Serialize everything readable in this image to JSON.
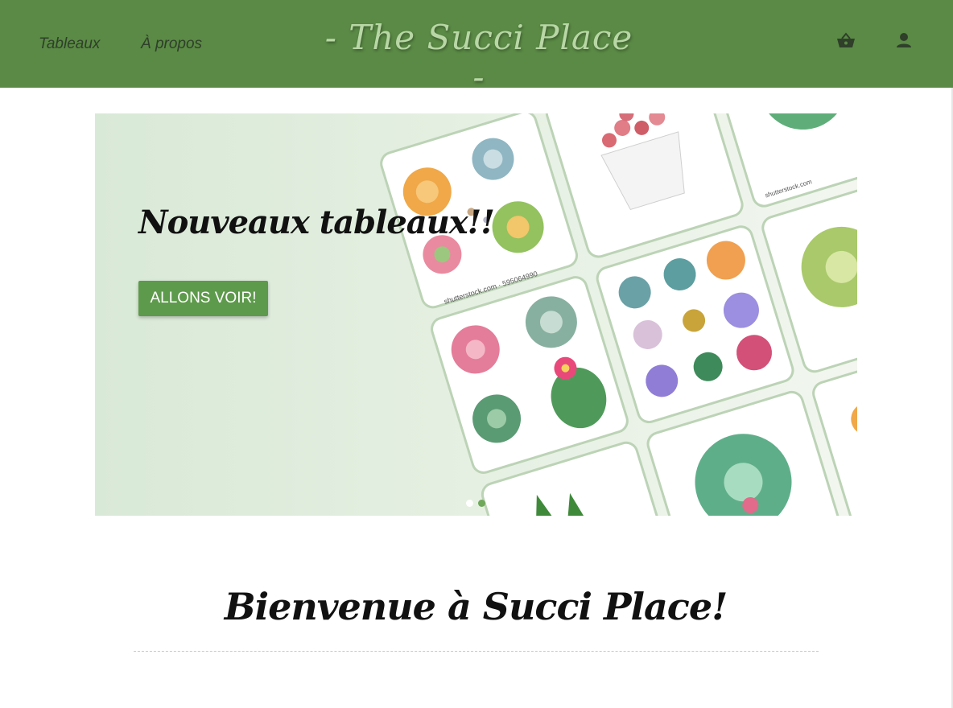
{
  "nav": {
    "links": [
      "Tableaux",
      "À propos"
    ],
    "brand": "- The Succi Place -",
    "icons": [
      "basket-icon",
      "user-icon"
    ]
  },
  "hero": {
    "title": "Nouveaux tableaux!!",
    "cta_label": "ALLONS VOIR!",
    "slides_count": 2,
    "active_slide": 2,
    "card_captions": [
      "shutterstock.com · 595064990",
      "shutterstock.com"
    ]
  },
  "welcome": {
    "title": "Bienvenue à Succi Place!"
  },
  "colors": {
    "header": "#5a8a45",
    "brand_text": "#b9d7a6",
    "button": "#5e9a4c",
    "hero_bg": "#e2eee0"
  }
}
